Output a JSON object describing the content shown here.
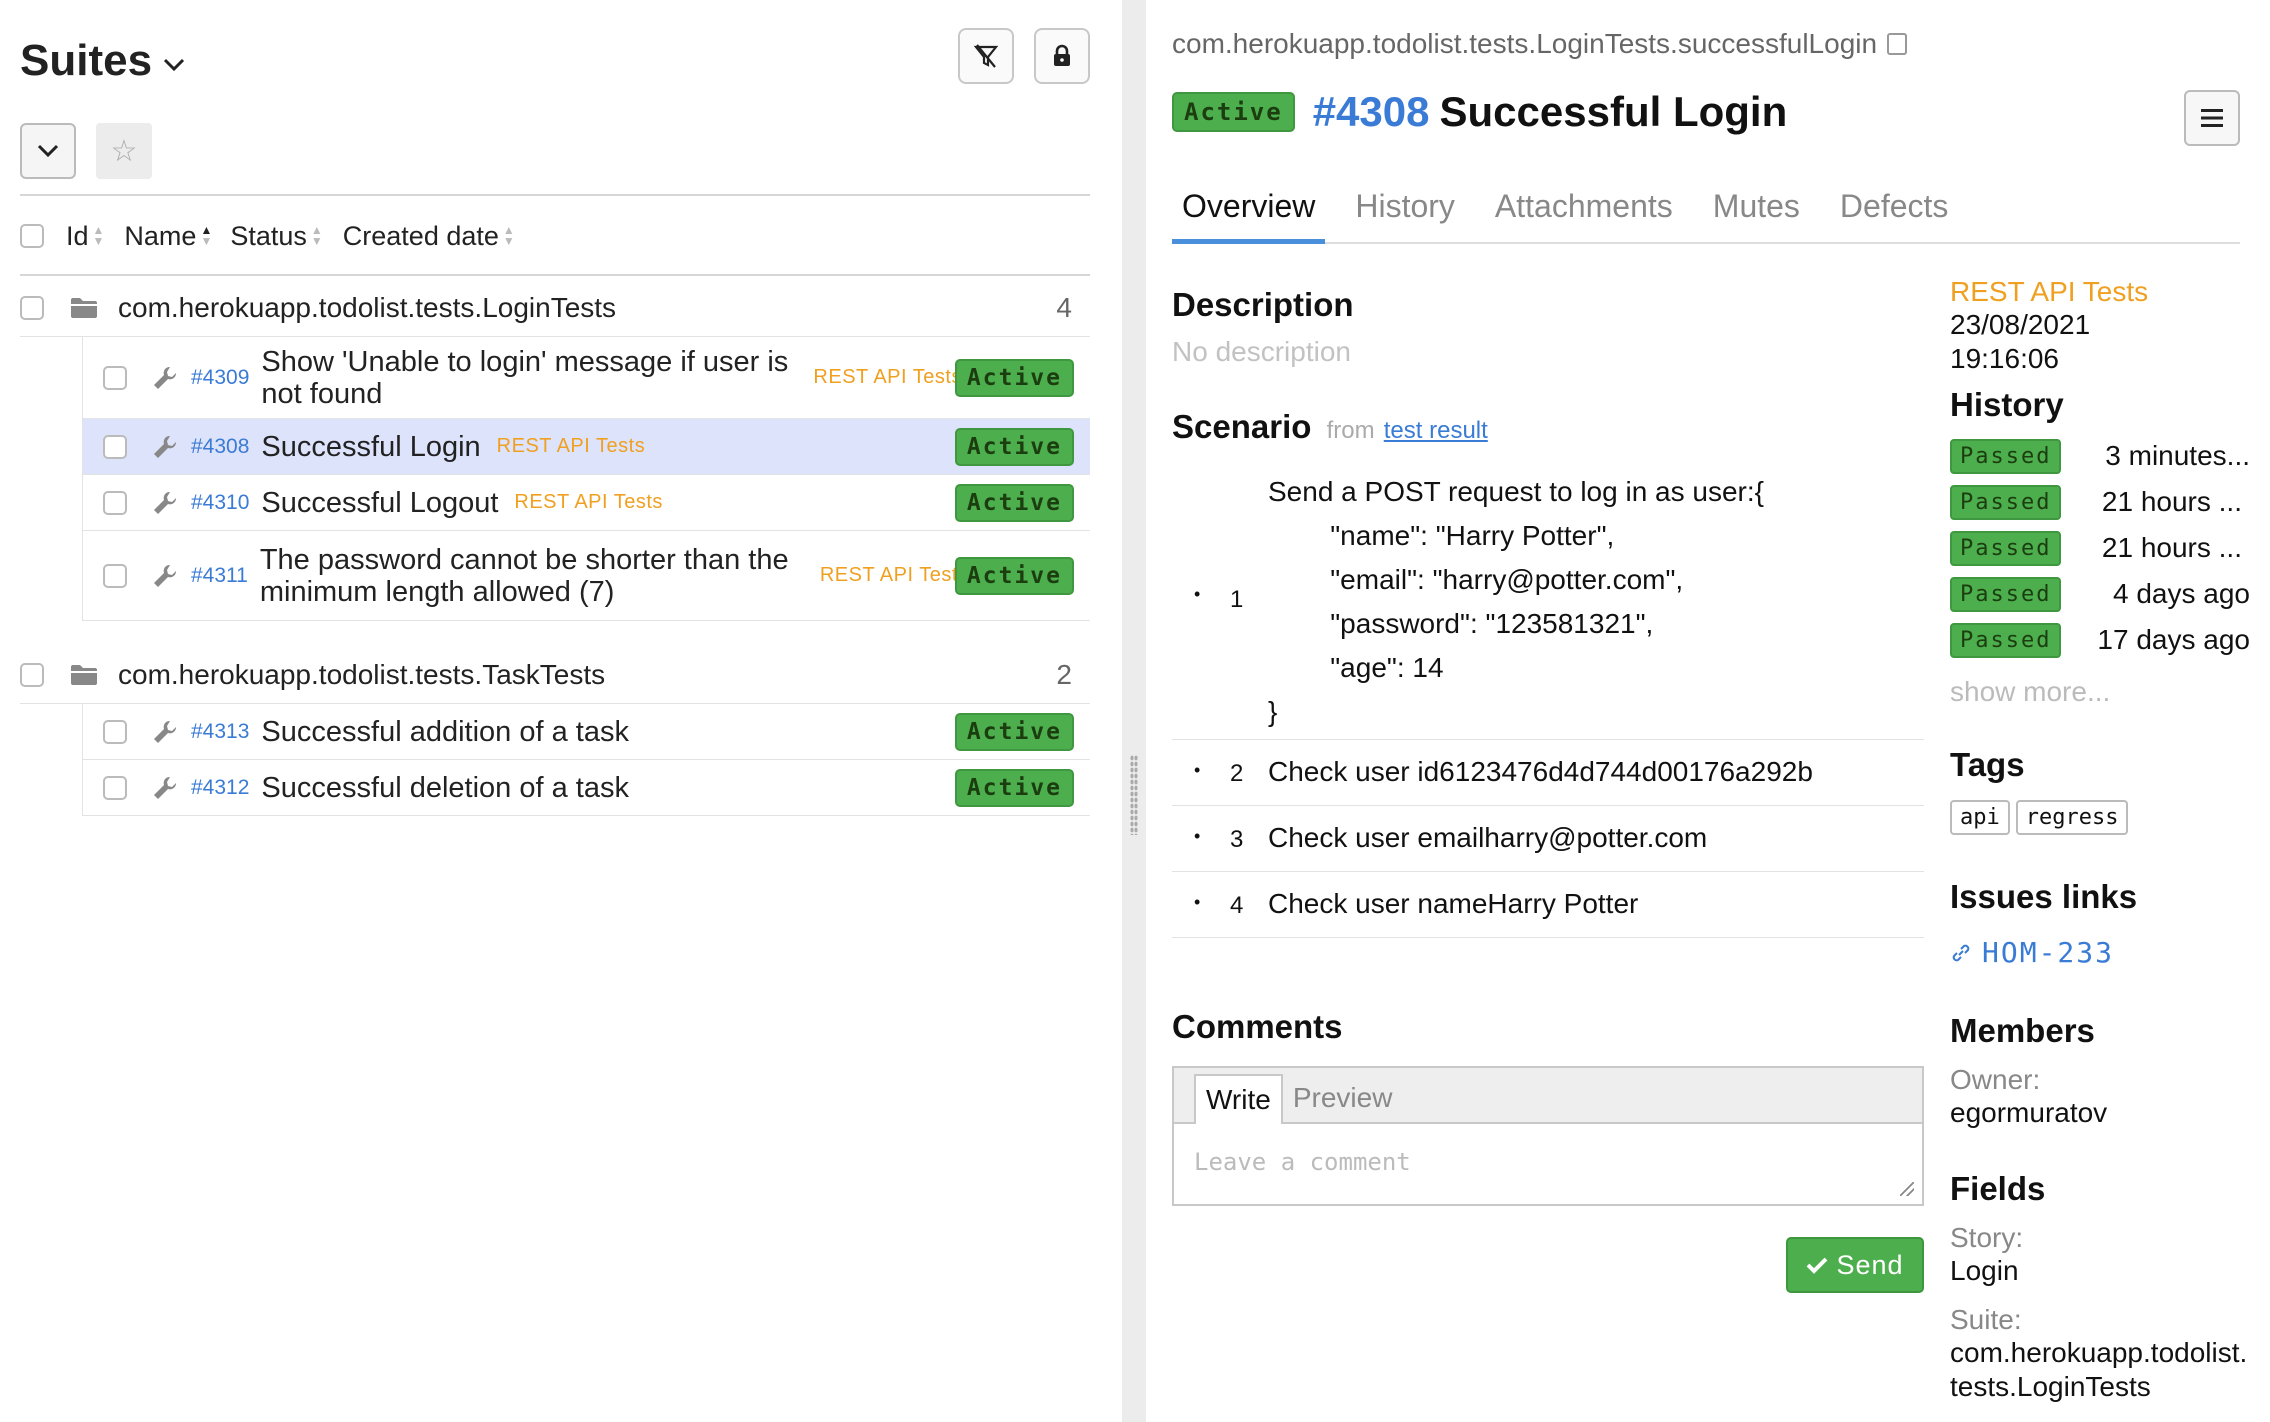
{
  "left": {
    "title": "Suites",
    "columns": {
      "id": "Id",
      "name": "Name",
      "status": "Status",
      "created": "Created date"
    },
    "suites": [
      {
        "name": "com.herokuapp.todolist.tests.LoginTests",
        "count": "4",
        "cases": [
          {
            "id": "#4309",
            "title": "Show 'Unable to login' message if user is not found",
            "layer": "REST API Tests",
            "status": "Active"
          },
          {
            "id": "#4308",
            "title": "Successful Login",
            "layer": "REST API Tests",
            "status": "Active"
          },
          {
            "id": "#4310",
            "title": "Successful Logout",
            "layer": "REST API Tests",
            "status": "Active"
          },
          {
            "id": "#4311",
            "title": "The password cannot be shorter than the minimum length allowed (7)",
            "layer": "REST API Tests",
            "status": "Active"
          }
        ]
      },
      {
        "name": "com.herokuapp.todolist.tests.TaskTests",
        "count": "2",
        "cases": [
          {
            "id": "#4313",
            "title": "Successful addition of a task",
            "layer": "",
            "status": "Active"
          },
          {
            "id": "#4312",
            "title": "Successful deletion of a task",
            "layer": "",
            "status": "Active"
          }
        ]
      }
    ]
  },
  "right": {
    "fqn": "com.herokuapp.todolist.tests.LoginTests.successfulLogin",
    "status": "Active",
    "number": "#4308",
    "title": "Successful Login",
    "tabs": [
      "Overview",
      "History",
      "Attachments",
      "Mutes",
      "Defects"
    ],
    "description": {
      "heading": "Description",
      "text": "No description"
    },
    "scenario": {
      "heading": "Scenario",
      "from": "from",
      "link": "test result",
      "steps": [
        {
          "n": "1",
          "text": "Send a POST request to log in as user:{\n        \"name\": \"Harry Potter\",\n        \"email\": \"harry@potter.com\",\n        \"password\": \"123581321\",\n        \"age\": 14\n}"
        },
        {
          "n": "2",
          "text": "Check user id6123476d4d744d00176a292b"
        },
        {
          "n": "3",
          "text": "Check user emailharry@potter.com"
        },
        {
          "n": "4",
          "text": "Check user nameHarry Potter"
        }
      ]
    },
    "comments": {
      "heading": "Comments",
      "tab_write": "Write",
      "tab_preview": "Preview",
      "placeholder": "Leave a comment",
      "send": "Send"
    },
    "side": {
      "layer": "REST API Tests",
      "date": "23/08/2021",
      "time": "19:16:06",
      "history_heading": "History",
      "history": [
        {
          "status": "Passed",
          "when": "3 minutes..."
        },
        {
          "status": "Passed",
          "when": "21 hours ..."
        },
        {
          "status": "Passed",
          "when": "21 hours ..."
        },
        {
          "status": "Passed",
          "when": "4 days ago"
        },
        {
          "status": "Passed",
          "when": "17 days ago"
        }
      ],
      "show_more": "show more...",
      "tags_heading": "Tags",
      "tags": [
        "api",
        "regress"
      ],
      "issues_heading": "Issues links",
      "issue": "HOM-233",
      "members_heading": "Members",
      "owner_label": "Owner:",
      "owner": "egormuratov",
      "fields_heading": "Fields",
      "story_label": "Story:",
      "story": "Login",
      "suite_label": "Suite:",
      "suite": "com.herokuapp.todolist.tests.LoginTests"
    }
  },
  "colors": {
    "accent": "#3a7bd5",
    "active_green": "#4cae4c",
    "layer_orange": "#f0a020",
    "selected_row": "#dde3fb"
  }
}
